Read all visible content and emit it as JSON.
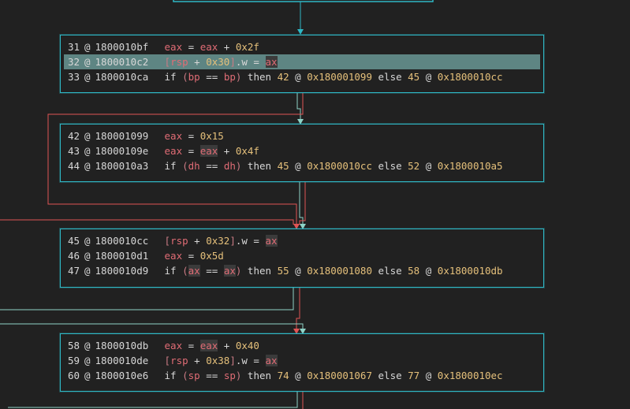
{
  "blocks": [
    {
      "lines": [
        {
          "index": "31",
          "addr": "1800010bf",
          "tokens": [
            [
              "reg",
              "eax"
            ],
            [
              "op",
              " = "
            ],
            [
              "reg",
              "eax"
            ],
            [
              "op",
              " + "
            ],
            [
              "imm",
              "0x2f"
            ]
          ]
        },
        {
          "index": "32",
          "addr": "1800010c2",
          "selected": true,
          "tokens": [
            [
              "brk",
              "["
            ],
            [
              "reg",
              "rsp"
            ],
            [
              "op",
              " + "
            ],
            [
              "imm",
              "0x30"
            ],
            [
              "brk",
              "]"
            ],
            [
              "op",
              ".w = "
            ],
            [
              "regh",
              "ax"
            ]
          ]
        },
        {
          "index": "33",
          "addr": "1800010ca",
          "tokens": [
            [
              "kw",
              "if "
            ],
            [
              "brk",
              "("
            ],
            [
              "reg",
              "bp"
            ],
            [
              "op",
              " == "
            ],
            [
              "reg",
              "bp"
            ],
            [
              "brk",
              ")"
            ],
            [
              "kw",
              " then "
            ],
            [
              "imm",
              "42"
            ],
            [
              "op",
              " @ "
            ],
            [
              "imm",
              "0x180001099"
            ],
            [
              "kw",
              " else "
            ],
            [
              "imm",
              "45"
            ],
            [
              "op",
              " @ "
            ],
            [
              "imm",
              "0x1800010cc"
            ]
          ]
        }
      ]
    },
    {
      "lines": [
        {
          "index": "42",
          "addr": "180001099",
          "tokens": [
            [
              "reg",
              "eax"
            ],
            [
              "op",
              " = "
            ],
            [
              "imm",
              "0x15"
            ]
          ]
        },
        {
          "index": "43",
          "addr": "18000109e",
          "tokens": [
            [
              "reg",
              "eax"
            ],
            [
              "op",
              " = "
            ],
            [
              "regh",
              "eax"
            ],
            [
              "op",
              " + "
            ],
            [
              "imm",
              "0x4f"
            ]
          ]
        },
        {
          "index": "44",
          "addr": "1800010a3",
          "tokens": [
            [
              "kw",
              "if "
            ],
            [
              "brk",
              "("
            ],
            [
              "reg",
              "dh"
            ],
            [
              "op",
              " == "
            ],
            [
              "reg",
              "dh"
            ],
            [
              "brk",
              ")"
            ],
            [
              "kw",
              " then "
            ],
            [
              "imm",
              "45"
            ],
            [
              "op",
              " @ "
            ],
            [
              "imm",
              "0x1800010cc"
            ],
            [
              "kw",
              " else "
            ],
            [
              "imm",
              "52"
            ],
            [
              "op",
              " @ "
            ],
            [
              "imm",
              "0x1800010a5"
            ]
          ]
        }
      ]
    },
    {
      "lines": [
        {
          "index": "45",
          "addr": "1800010cc",
          "tokens": [
            [
              "brk",
              "["
            ],
            [
              "reg",
              "rsp"
            ],
            [
              "op",
              " + "
            ],
            [
              "imm",
              "0x32"
            ],
            [
              "brk",
              "]"
            ],
            [
              "op",
              ".w = "
            ],
            [
              "regh",
              "ax"
            ]
          ]
        },
        {
          "index": "46",
          "addr": "1800010d1",
          "tokens": [
            [
              "reg",
              "eax"
            ],
            [
              "op",
              " = "
            ],
            [
              "imm",
              "0x5d"
            ]
          ]
        },
        {
          "index": "47",
          "addr": "1800010d9",
          "tokens": [
            [
              "kw",
              "if "
            ],
            [
              "brk",
              "("
            ],
            [
              "regh",
              "ax"
            ],
            [
              "op",
              " == "
            ],
            [
              "regh",
              "ax"
            ],
            [
              "brk",
              ")"
            ],
            [
              "kw",
              " then "
            ],
            [
              "imm",
              "55"
            ],
            [
              "op",
              " @ "
            ],
            [
              "imm",
              "0x180001080"
            ],
            [
              "kw",
              " else "
            ],
            [
              "imm",
              "58"
            ],
            [
              "op",
              " @ "
            ],
            [
              "imm",
              "0x1800010db"
            ]
          ]
        }
      ]
    },
    {
      "lines": [
        {
          "index": "58",
          "addr": "1800010db",
          "tokens": [
            [
              "reg",
              "eax"
            ],
            [
              "op",
              " = "
            ],
            [
              "regh",
              "eax"
            ],
            [
              "op",
              " + "
            ],
            [
              "imm",
              "0x40"
            ]
          ]
        },
        {
          "index": "59",
          "addr": "1800010de",
          "tokens": [
            [
              "brk",
              "["
            ],
            [
              "reg",
              "rsp"
            ],
            [
              "op",
              " + "
            ],
            [
              "imm",
              "0x38"
            ],
            [
              "brk",
              "]"
            ],
            [
              "op",
              ".w = "
            ],
            [
              "regh",
              "ax"
            ]
          ]
        },
        {
          "index": "60",
          "addr": "1800010e6",
          "tokens": [
            [
              "kw",
              "if "
            ],
            [
              "brk",
              "("
            ],
            [
              "reg",
              "sp"
            ],
            [
              "op",
              " == "
            ],
            [
              "reg",
              "sp"
            ],
            [
              "brk",
              ")"
            ],
            [
              "kw",
              " then "
            ],
            [
              "imm",
              "74"
            ],
            [
              "op",
              " @ "
            ],
            [
              "imm",
              "0x180001067"
            ],
            [
              "kw",
              " else "
            ],
            [
              "imm",
              "77"
            ],
            [
              "op",
              " @ "
            ],
            [
              "imm",
              "0x1800010ec"
            ]
          ]
        }
      ]
    }
  ],
  "colors": {
    "block_border": "#2fb7c5",
    "edge_false": "#e05555",
    "edge_true": "#8fd3c7",
    "edge_unconditional": "#2fb7c5"
  }
}
